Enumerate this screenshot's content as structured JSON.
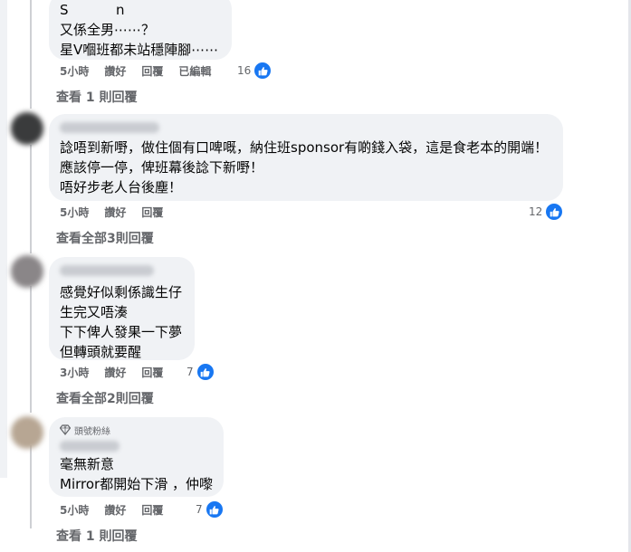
{
  "comments": [
    {
      "name_partial": "S           n",
      "lines": [
        "又係全男⋯⋯？",
        "星V嗰班都未站穩陣腳⋯⋯"
      ],
      "time": "5小時",
      "like": "讚好",
      "reply": "回覆",
      "edited": "已編輯",
      "reactions": "16",
      "view_replies": "查看 1 則回覆"
    },
    {
      "lines": [
        "諗唔到新嘢，做住個有口啤嘅，納住班sponsor有啲錢入袋，這是食老本的開端！",
        "應該停一停，俾班幕後諗下新嘢！",
        "唔好步老人台後塵！"
      ],
      "time": "5小時",
      "like": "讚好",
      "reply": "回覆",
      "reactions": "12",
      "view_replies": "查看全部3則回覆"
    },
    {
      "lines": [
        "感覺好似剩係識生仔",
        "生完又唔湊",
        "下下俾人發果一下夢",
        "但轉頭就要醒"
      ],
      "time": "3小時",
      "like": "讚好",
      "reply": "回覆",
      "reactions": "7",
      "view_replies": "查看全部2則回覆"
    },
    {
      "badge": "頭號粉絲",
      "lines": [
        "毫無新意",
        "Mirror都開始下滑 ，仲嚟"
      ],
      "time": "5小時",
      "like": "讚好",
      "reply": "回覆",
      "reactions": "7",
      "view_replies": "查看 1 則回覆"
    }
  ],
  "colors": {
    "bubble": "#f0f2f5",
    "meta_text": "#65676b",
    "like_blue": "#1877f2"
  },
  "icons": {
    "reaction": "thumbs-up-icon",
    "badge": "diamond-icon"
  }
}
